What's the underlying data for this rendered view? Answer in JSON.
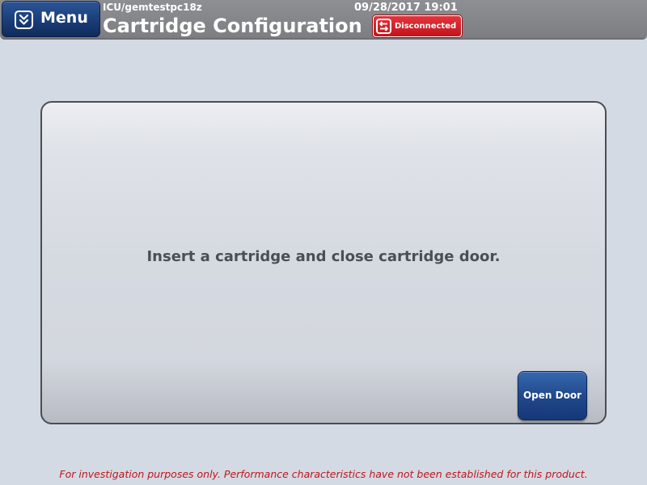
{
  "header": {
    "menu_label": "Menu",
    "menu_icon": "chevron-double-down-icon",
    "location": "ICU/gemtestpc18z",
    "datetime": "09/28/2017 19:01",
    "title": "Cartridge Configuration",
    "status": {
      "label": "Disconnected",
      "icon": "swap-arrows-icon",
      "color": "#d4222a"
    }
  },
  "main": {
    "instruction": "Insert a cartridge and close cartridge door.",
    "open_door_label": "Open Door"
  },
  "footer": {
    "disclaimer": "For investigation purposes only.  Performance characteristics have not been established for this product."
  },
  "colors": {
    "background": "#d4dae3",
    "header": "#858689",
    "button_blue": "#21498c",
    "alert_red": "#c0141c"
  }
}
